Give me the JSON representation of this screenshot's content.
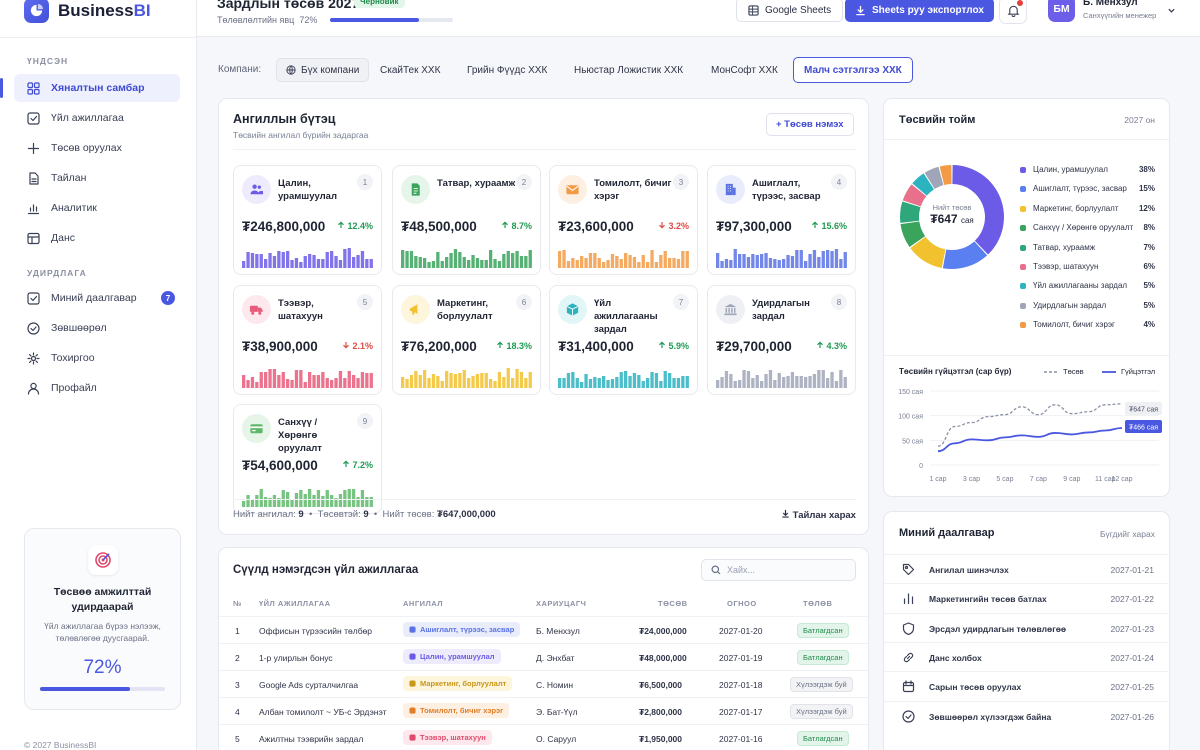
{
  "app": {
    "name_main": "Business",
    "name_accent": "BI"
  },
  "sidebar": {
    "section_main": "ҮНДСЭН",
    "main_items": [
      {
        "label": "Хяналтын самбар",
        "icon": "dashboard-grid-icon"
      },
      {
        "label": "Үйл ажиллагаа",
        "icon": "check-square-icon"
      },
      {
        "label": "Төсөв оруулах",
        "icon": "plus-icon"
      },
      {
        "label": "Тайлан",
        "icon": "document-icon"
      },
      {
        "label": "Аналитик",
        "icon": "chart-icon"
      },
      {
        "label": "Данс",
        "icon": "table-icon"
      }
    ],
    "section_manage": "УДИРДЛАГА",
    "manage_items": [
      {
        "label": "Миний даалгавар",
        "icon": "task-icon",
        "badge": "7"
      },
      {
        "label": "Зөвшөөрөл",
        "icon": "check-circle-icon"
      },
      {
        "label": "Тохиргоо",
        "icon": "gear-icon"
      },
      {
        "label": "Профайл",
        "icon": "user-icon"
      }
    ],
    "promo": {
      "title": "Төсвөө амжилттай удирдаарай",
      "text": "Үйл ажиллагаа бүрээ нэлээж, төлөвлөгөө дуусгаарай.",
      "percent_label": "72%",
      "percent": 72
    },
    "copyright": "© 2027 BusinessBI"
  },
  "header": {
    "title": "Зардлын төсөв 2027",
    "status_badge": "Черновик",
    "progress_label": "Төлөвлөлтийн явц",
    "progress_value": "72%",
    "progress": 72,
    "sheets_button": "Google Sheets",
    "export_button": "Sheets руу экспортлох",
    "user": {
      "initials": "БМ",
      "name": "Б. Менхзул",
      "role": "Санхүүгийн менежер"
    }
  },
  "companies": {
    "label": "Компани:",
    "tabs": [
      "Бүх компани",
      "СкайТек ХХК",
      "Грийн Фүүдс ХХК",
      "Ньюстар Ложистик ХХК",
      "МонСофт ХХК",
      "Малч сэтгэлгээ ХХК"
    ],
    "selected": 5
  },
  "categories": {
    "title": "Ангиллын бүтэц",
    "subtitle": "Төсвийн ангилал бүрийн задаргаа",
    "add_button": "+ Төсөв нэмэх",
    "items": [
      {
        "num": "1",
        "name": "Цалин, урамшуулал",
        "amount": "₮246,800,000",
        "change": "12.4%",
        "dir": "up",
        "color": "#6b5be6",
        "bg": "#eeecfc",
        "icon": "users-icon"
      },
      {
        "num": "2",
        "name": "Татвар, хураамж",
        "amount": "₮48,500,000",
        "change": "8.7%",
        "dir": "up",
        "color": "#3aa35c",
        "bg": "#e6f5ea",
        "icon": "receipt-icon"
      },
      {
        "num": "3",
        "name": "Томилолт, бичиг хэрэг",
        "amount": "₮23,600,000",
        "change": "3.2%",
        "dir": "down",
        "color": "#f29b44",
        "bg": "#fdf0e2",
        "icon": "envelope-icon"
      },
      {
        "num": "4",
        "name": "Ашиглалт, түрээс, засвар",
        "amount": "₮97,300,000",
        "change": "15.6%",
        "dir": "up",
        "color": "#5a72e4",
        "bg": "#e9edfb",
        "icon": "building-icon"
      },
      {
        "num": "5",
        "name": "Тээвэр, шатахуун",
        "amount": "₮38,900,000",
        "change": "2.1%",
        "dir": "down",
        "color": "#e85b7a",
        "bg": "#fce8ed",
        "icon": "truck-icon"
      },
      {
        "num": "6",
        "name": "Маркетинг, борлуулалт",
        "amount": "₮76,200,000",
        "change": "18.3%",
        "dir": "up",
        "color": "#f2c12e",
        "bg": "#fdf5dc",
        "icon": "megaphone-icon"
      },
      {
        "num": "7",
        "name": "Үйл ажиллагааны зардал",
        "amount": "₮31,400,000",
        "change": "5.9%",
        "dir": "up",
        "color": "#2bb3c0",
        "bg": "#e2f5f7",
        "icon": "box-icon"
      },
      {
        "num": "8",
        "name": "Удирдлагын зардал",
        "amount": "₮29,700,000",
        "change": "4.3%",
        "dir": "up",
        "color": "#a0a6b8",
        "bg": "#eff0f4",
        "icon": "bank-icon"
      },
      {
        "num": "9",
        "name": "Санхүү / Хөрөнгө оруулалт",
        "amount": "₮54,600,000",
        "change": "7.2%",
        "dir": "up",
        "color": "#5fb86a",
        "bg": "#e6f5e8",
        "icon": "card-icon"
      }
    ],
    "summary": {
      "count_label": "Нийт ангилал:",
      "count": "9",
      "approved_label": "Төсөвтэй:",
      "approved": "9",
      "total_label": "Нийт төсөв:",
      "total": "₮647,000,000"
    },
    "report_link": "Тайлан харах"
  },
  "activity": {
    "title": "Сүүлд нэмэгдсэн үйл ажиллагаа",
    "search_placeholder": "Хайх...",
    "columns": [
      "№",
      "ҮЙЛ АЖИЛЛАГАА",
      "АНГИЛАЛ",
      "ХАРИУЦАГЧ",
      "ТӨСӨВ",
      "ОГНОО",
      "ТӨЛӨВ"
    ],
    "rows": [
      {
        "no": "1",
        "name": "Оффисын түрээсийн төлбөр",
        "category": "Ашиглалт, түрээс, засвар",
        "cat_color": "#5a72e4",
        "cat_bg": "#e9edfb",
        "owner": "Б. Менхзул",
        "amount": "₮24,000,000",
        "date": "2027-01-20",
        "status": "Батлагдсан",
        "ok": true
      },
      {
        "no": "2",
        "name": "1-р улирлын бонус",
        "category": "Цалин, урамшуулал",
        "cat_color": "#6b5be6",
        "cat_bg": "#eeecfc",
        "owner": "Д. Энхбат",
        "amount": "₮48,000,000",
        "date": "2027-01-19",
        "status": "Батлагдсан",
        "ok": true
      },
      {
        "no": "3",
        "name": "Google Ads сурталчилгаа",
        "category": "Маркетинг, борлуулалт",
        "cat_color": "#c9971a",
        "cat_bg": "#fdf5dc",
        "owner": "С. Номин",
        "amount": "₮6,500,000",
        "date": "2027-01-18",
        "status": "Хүлээгдэж буй",
        "ok": false
      },
      {
        "no": "4",
        "name": "Албан томилолт ~ УБ-с Эрдэнэт",
        "category": "Томилолт, бичиг хэрэг",
        "cat_color": "#e07f2a",
        "cat_bg": "#fdf0e2",
        "owner": "Э. Бат-Үүл",
        "amount": "₮2,800,000",
        "date": "2027-01-17",
        "status": "Хүлээгдэж буй",
        "ok": false
      },
      {
        "no": "5",
        "name": "Ажилтны тээврийн зардал",
        "category": "Тээвэр, шатахуун",
        "cat_color": "#e04a6c",
        "cat_bg": "#fce8ed",
        "owner": "О. Саруул",
        "amount": "₮1,950,000",
        "date": "2027-01-16",
        "status": "Батлагдсан",
        "ok": true
      }
    ]
  },
  "overview": {
    "title": "Төсвийн тойм",
    "year": "2027 он",
    "donut_caption": "Нийт төсөв",
    "donut_value": "₮647",
    "donut_unit": "сая",
    "line_title": "Төсвийн гүйцэтгэл (сар бүр)",
    "legend_plan": "Төсөв",
    "legend_actual": "Гүйцэтгэл",
    "plan_label": "₮647 сая",
    "actual_label": "₮466 сая"
  },
  "chart_data": [
    {
      "type": "pie",
      "title": "Төсвийн тойм",
      "labels": [
        "Цалин, урамшуулал",
        "Ашиглалт, түрээс, засвар",
        "Маркетинг, борлуулалт",
        "Санхүү / Хөрөнгө оруулалт",
        "Татвар, хураамж",
        "Тээвэр, шатахуун",
        "Үйл ажиллагааны зардал",
        "Удирдлагын зардал",
        "Томилолт, бичиг хэрэг"
      ],
      "pct_labels": [
        "38%",
        "15%",
        "12%",
        "8%",
        "7%",
        "6%",
        "5%",
        "5%",
        "4%"
      ],
      "values": [
        38,
        15,
        12,
        8,
        7,
        6,
        5,
        5,
        4
      ],
      "colors": [
        "#6b5be6",
        "#5a7ff0",
        "#f2c12e",
        "#3aa35c",
        "#2ea87a",
        "#e8708a",
        "#2bb3c0",
        "#a0a6b8",
        "#f29b44"
      ],
      "legend": "right"
    },
    {
      "type": "line",
      "title": "Төсвийн гүйцэтгэл (сар бүр)",
      "x": [
        "1 сар",
        "3 сар",
        "5 сар",
        "7 сар",
        "9 сар",
        "11 сар",
        "12 сар"
      ],
      "yticks": [
        "150 сая",
        "100 сая",
        "50 сая",
        "0"
      ],
      "ylim": [
        0,
        150
      ],
      "series": [
        {
          "name": "Төсөв",
          "style": "dashed",
          "color": "#8a90a6",
          "values": [
            38,
            78,
            86,
            98,
            102,
            118,
            102,
            122,
            104,
            108,
            122,
            124
          ]
        },
        {
          "name": "Гүйцэтгэл",
          "style": "solid",
          "color": "#4a57e0",
          "values": [
            28,
            44,
            52,
            50,
            56,
            60,
            57,
            65,
            62,
            66,
            70,
            75
          ]
        }
      ]
    }
  ],
  "tasks": {
    "title": "Миний даалгавар",
    "view_all": "Бүгдийг харах",
    "items": [
      {
        "name": "Ангилал шинэчлэх",
        "date": "2027-01-21",
        "icon": "tag-icon"
      },
      {
        "name": "Маркетингийн төсөв батлах",
        "date": "2027-01-22",
        "icon": "bar-chart-icon"
      },
      {
        "name": "Эрсдэл удирдлагын төлөвлөгөө",
        "date": "2027-01-23",
        "icon": "shield-icon"
      },
      {
        "name": "Данс холбох",
        "date": "2027-01-24",
        "icon": "link-icon"
      },
      {
        "name": "Сарын төсөв оруулах",
        "date": "2027-01-25",
        "icon": "calendar-icon"
      },
      {
        "name": "Зөвшөөрөл хүлээгдэж байна",
        "date": "2027-01-26",
        "icon": "check-circle-icon"
      }
    ]
  }
}
